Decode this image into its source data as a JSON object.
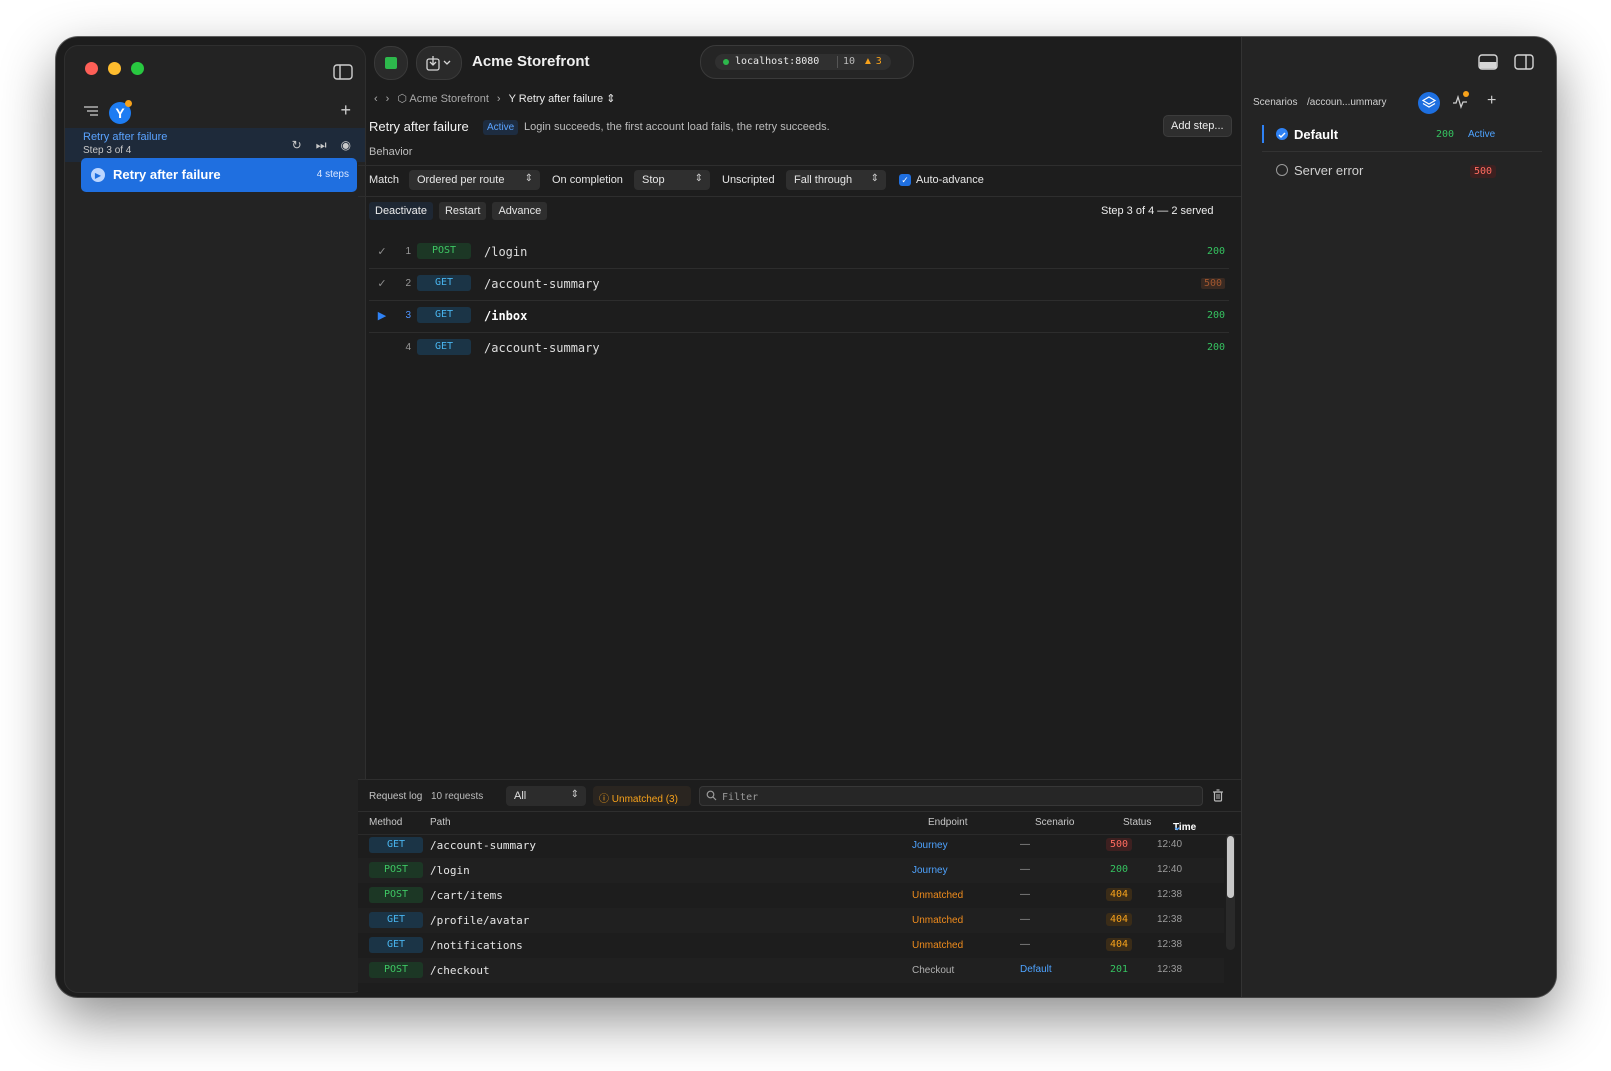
{
  "toolbar": {
    "app_title": "Acme Storefront",
    "server_host": "localhost:8080",
    "server_count": "10",
    "server_warnings": "3"
  },
  "sidebar": {
    "active_journey": {
      "title": "Retry after failure",
      "subtitle": "Step 3 of 4"
    },
    "journeys": [
      {
        "label": "Retry after failure",
        "count": "4 steps"
      }
    ]
  },
  "breadcrumb": {
    "project": "Acme Storefront",
    "journey": "Retry after failure"
  },
  "journey": {
    "title": "Retry after failure",
    "badge": "Active",
    "description": "Login succeeds, the first account load fails, the retry succeeds.",
    "add_step_label": "Add step...",
    "behavior_label": "Behavior",
    "match_label": "Match",
    "match_value": "Ordered per route",
    "on_completion_label": "On completion",
    "on_completion_value": "Stop",
    "unscripted_label": "Unscripted",
    "unscripted_value": "Fall through",
    "auto_advance_label": "Auto-advance",
    "auto_advance_checked": true,
    "deactivate_label": "Deactivate",
    "restart_label": "Restart",
    "advance_label": "Advance",
    "step_status": "Step 3 of 4 — 2 served"
  },
  "steps": [
    {
      "num": "1",
      "method": "POST",
      "path": "/login",
      "status": "200",
      "state": "done"
    },
    {
      "num": "2",
      "method": "GET",
      "path": "/account-summary",
      "status": "500",
      "state": "done"
    },
    {
      "num": "3",
      "method": "GET",
      "path": "/inbox",
      "status": "200",
      "state": "current"
    },
    {
      "num": "4",
      "method": "GET",
      "path": "/account-summary",
      "status": "200",
      "state": "pending"
    }
  ],
  "request_log": {
    "title": "Request log",
    "count": "10 requests",
    "filter_select": "All",
    "unmatched": "Unmatched (3)",
    "filter_placeholder": "Filter",
    "columns": {
      "method": "Method",
      "path": "Path",
      "endpoint": "Endpoint",
      "scenario": "Scenario",
      "status": "Status",
      "time": "Time"
    },
    "rows": [
      {
        "method": "GET",
        "path": "/account-summary",
        "endpoint": "Journey",
        "scenario": "—",
        "status": "500",
        "time": "12:40"
      },
      {
        "method": "POST",
        "path": "/login",
        "endpoint": "Journey",
        "scenario": "—",
        "status": "200",
        "time": "12:40"
      },
      {
        "method": "POST",
        "path": "/cart/items",
        "endpoint": "Unmatched",
        "scenario": "—",
        "status": "404",
        "time": "12:38"
      },
      {
        "method": "GET",
        "path": "/profile/avatar",
        "endpoint": "Unmatched",
        "scenario": "—",
        "status": "404",
        "time": "12:38"
      },
      {
        "method": "GET",
        "path": "/notifications",
        "endpoint": "Unmatched",
        "scenario": "—",
        "status": "404",
        "time": "12:38"
      },
      {
        "method": "POST",
        "path": "/checkout",
        "endpoint": "Checkout",
        "scenario": "Default",
        "status": "201",
        "time": "12:38"
      }
    ]
  },
  "scenarios": {
    "title": "Scenarios",
    "path": "/accoun...ummary",
    "items": [
      {
        "name": "Default",
        "status": "200",
        "active_label": "Active"
      },
      {
        "name": "Server error",
        "status": "500"
      }
    ]
  },
  "colors": {
    "accent": "#1f6fe0",
    "success": "#35c260",
    "warning": "#f7a21b",
    "error": "#ff6b5f"
  },
  "icons": {
    "sidebar_toggle": "sidebar-toggle-icon",
    "stop": "stop-icon",
    "download": "download-icon",
    "layers": "layers-icon",
    "activity": "activity-icon",
    "trash": "trash-icon"
  }
}
